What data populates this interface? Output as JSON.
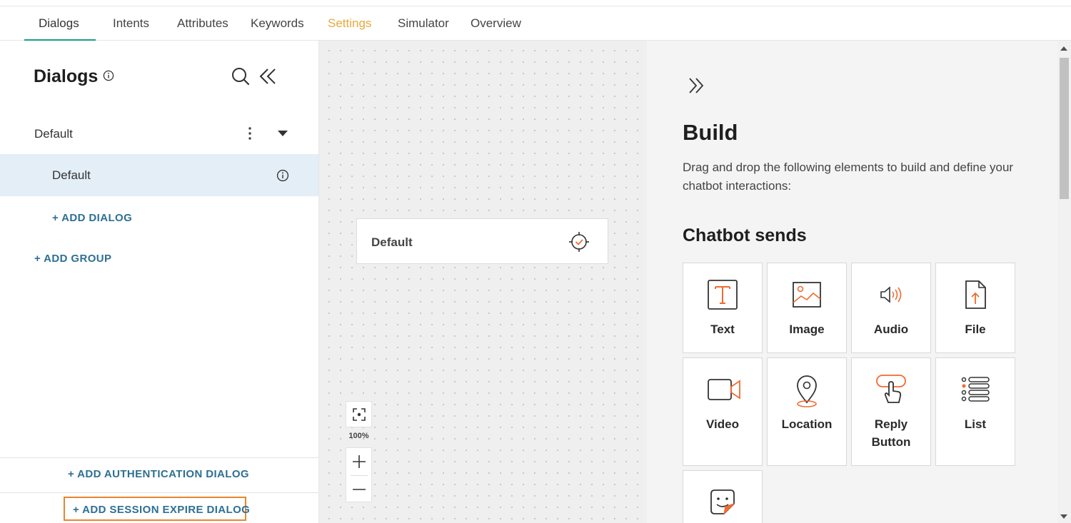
{
  "nav": {
    "tabs": [
      {
        "label": "Dialogs"
      },
      {
        "label": "Intents"
      },
      {
        "label": "Attributes"
      },
      {
        "label": "Keywords"
      },
      {
        "label": "Settings"
      },
      {
        "label": "Simulator"
      },
      {
        "label": "Overview"
      }
    ],
    "active_tab": "Dialogs"
  },
  "sidebar": {
    "title": "Dialogs",
    "group": {
      "label": "Default"
    },
    "dialog": {
      "label": "Default"
    },
    "add_dialog": "+ ADD DIALOG",
    "add_group": "+ ADD GROUP",
    "add_auth_dialog": "+ ADD AUTHENTICATION DIALOG",
    "add_session_expire_dialog": "+ ADD SESSION EXPIRE DIALOG"
  },
  "canvas": {
    "node": {
      "label": "Default"
    },
    "zoom_level": "100%"
  },
  "build_panel": {
    "title": "Build",
    "description": "Drag and drop the following elements to build and define your chatbot interactions:",
    "section_title": "Chatbot sends",
    "elements": [
      {
        "label": "Text",
        "icon": "text-icon"
      },
      {
        "label": "Image",
        "icon": "image-icon"
      },
      {
        "label": "Audio",
        "icon": "audio-icon"
      },
      {
        "label": "File",
        "icon": "file-icon"
      },
      {
        "label": "Video",
        "icon": "video-icon"
      },
      {
        "label": "Location",
        "icon": "location-icon"
      },
      {
        "label": "Reply Button",
        "icon": "reply-button-icon"
      },
      {
        "label": "List",
        "icon": "list-icon"
      },
      {
        "label": "",
        "icon": "sticker-icon"
      }
    ]
  },
  "colors": {
    "accent_green": "#1a9d84",
    "settings_tab": "#e8a93a",
    "link_blue": "#2d6f93",
    "icon_orange": "#ef6b30",
    "highlight_orange": "#e8862f",
    "selected_row": "#e4eef7"
  }
}
